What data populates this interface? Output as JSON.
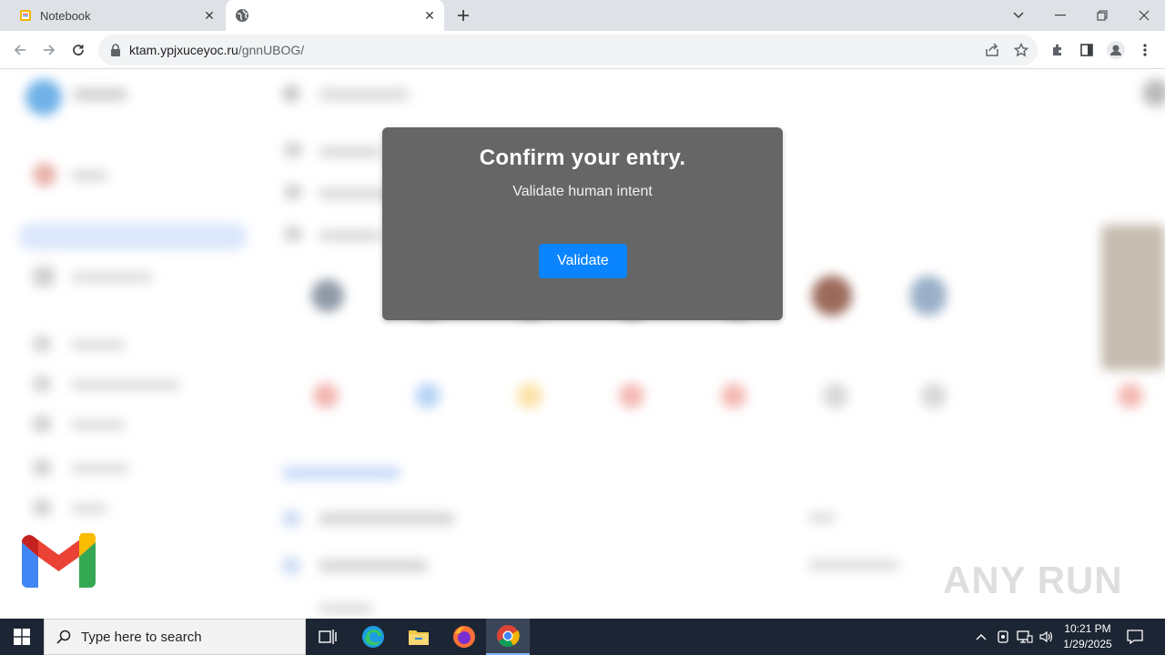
{
  "browser": {
    "tabs": [
      {
        "title": "Notebook",
        "favicon": "notebook-favicon",
        "active": false
      },
      {
        "title": "",
        "favicon": "globe-icon",
        "active": true
      }
    ],
    "url_host": "ktam.ypjxuceyoc.ru",
    "url_path": "/gnnUBOG/"
  },
  "modal": {
    "title": "Confirm your entry.",
    "subtitle": "Validate human intent",
    "button_label": "Validate",
    "button_color": "#0a84ff",
    "background_color": "#666666"
  },
  "watermark": "ANY RUN",
  "taskbar": {
    "search_placeholder": "Type here to search",
    "time": "10:21 PM",
    "date": "1/29/2025",
    "apps": [
      "task-view-icon",
      "edge-icon",
      "file-explorer-icon",
      "firefox-icon",
      "chrome-icon"
    ]
  }
}
